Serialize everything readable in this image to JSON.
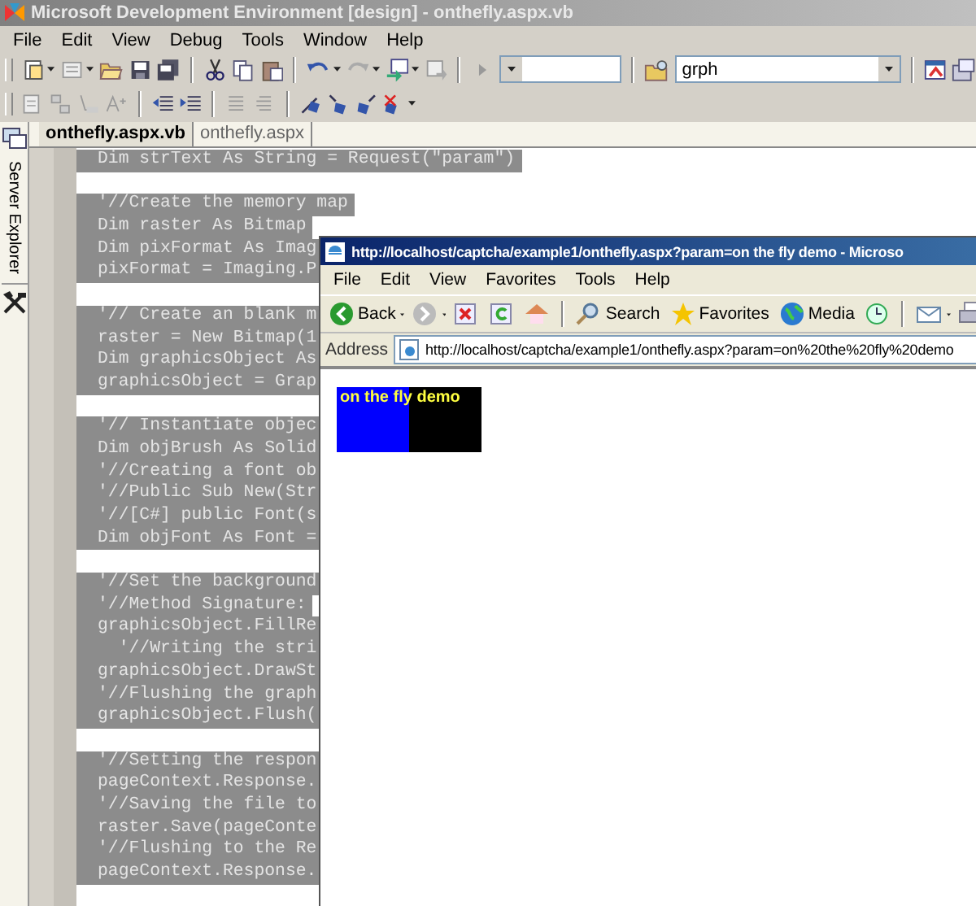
{
  "ide": {
    "title": "Microsoft Development Environment [design] - onthefly.aspx.vb",
    "menu": [
      "File",
      "Edit",
      "View",
      "Debug",
      "Tools",
      "Window",
      "Help"
    ],
    "find_combo": {
      "value": "grph"
    },
    "side_panel": {
      "label": "Server Explorer"
    },
    "tabs": [
      {
        "label": "onthefly.aspx.vb",
        "selected": true
      },
      {
        "label": "onthefly.aspx",
        "selected": false
      }
    ],
    "code_lines": [
      {
        "kind": "code",
        "text": "Dim strText As String = Request(\"param\")"
      },
      {
        "kind": "blank"
      },
      {
        "kind": "code",
        "text": "'//Create the memory map"
      },
      {
        "kind": "code",
        "text": "Dim raster As Bitmap"
      },
      {
        "kind": "code",
        "text": "Dim pixFormat As Imag"
      },
      {
        "kind": "code",
        "text": "pixFormat = Imaging.P"
      },
      {
        "kind": "blank"
      },
      {
        "kind": "code",
        "text": "'// Create an blank m"
      },
      {
        "kind": "code",
        "text": "raster = New Bitmap(1"
      },
      {
        "kind": "code",
        "text": "Dim graphicsObject As"
      },
      {
        "kind": "code",
        "text": "graphicsObject = Grap"
      },
      {
        "kind": "blank"
      },
      {
        "kind": "code",
        "text": "'// Instantiate objec"
      },
      {
        "kind": "code",
        "text": "Dim objBrush As Solid"
      },
      {
        "kind": "code",
        "text": "'//Creating a font ob"
      },
      {
        "kind": "code",
        "text": "'//Public Sub New(Str"
      },
      {
        "kind": "code",
        "text": "'//[C#] public Font(s"
      },
      {
        "kind": "code",
        "text": "Dim objFont As Font ="
      },
      {
        "kind": "blank"
      },
      {
        "kind": "code",
        "text": "'//Set the background"
      },
      {
        "kind": "code",
        "text": "'//Method Signature:"
      },
      {
        "kind": "code",
        "text": "graphicsObject.FillRe"
      },
      {
        "kind": "code",
        "text": "  '//Writing the stri"
      },
      {
        "kind": "code",
        "text": "graphicsObject.DrawSt"
      },
      {
        "kind": "code",
        "text": "'//Flushing the graph"
      },
      {
        "kind": "code",
        "text": "graphicsObject.Flush("
      },
      {
        "kind": "blank"
      },
      {
        "kind": "code",
        "text": "'//Setting the respon"
      },
      {
        "kind": "code",
        "text": "pageContext.Response."
      },
      {
        "kind": "code",
        "text": "'//Saving the file to"
      },
      {
        "kind": "code",
        "text": "raster.Save(pageConte"
      },
      {
        "kind": "code",
        "text": "'//Flushing to the Re"
      },
      {
        "kind": "code",
        "text": "pageContext.Response."
      },
      {
        "kind": "blank"
      }
    ]
  },
  "browser": {
    "title": "http://localhost/captcha/example1/onthefly.aspx?param=on the fly demo - Microso",
    "menu": [
      "File",
      "Edit",
      "View",
      "Favorites",
      "Tools",
      "Help"
    ],
    "toolbar": [
      {
        "kind": "back",
        "label": "Back"
      },
      {
        "kind": "forward"
      },
      {
        "kind": "stop"
      },
      {
        "kind": "refresh"
      },
      {
        "kind": "home"
      },
      {
        "kind": "search",
        "label": "Search"
      },
      {
        "kind": "favorites",
        "label": "Favorites"
      },
      {
        "kind": "media",
        "label": "Media"
      },
      {
        "kind": "history"
      },
      {
        "kind": "mail"
      },
      {
        "kind": "print"
      }
    ],
    "address_label": "Address",
    "url": "http://localhost/captcha/example1/onthefly.aspx?param=on%20the%20fly%20demo",
    "image_text": "on the fly demo"
  }
}
